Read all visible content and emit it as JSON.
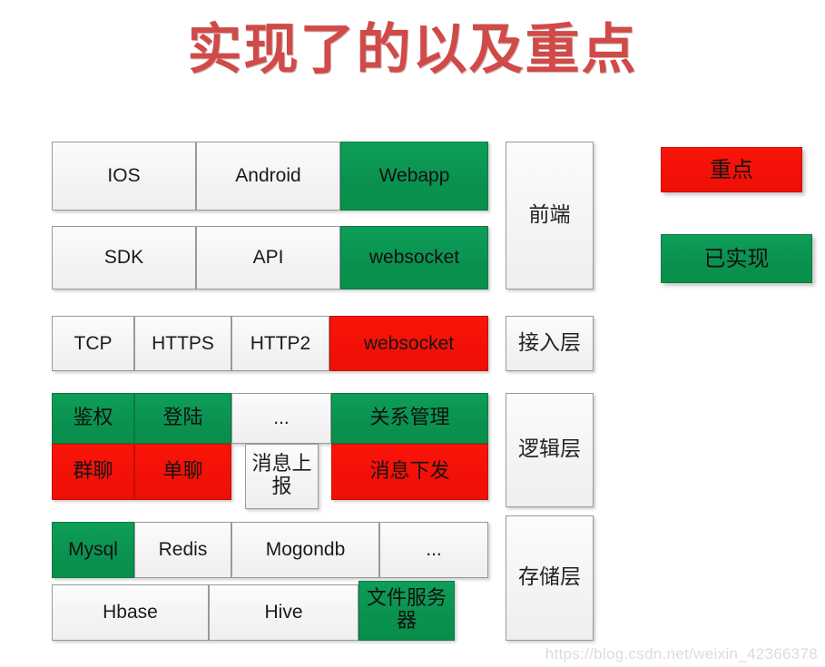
{
  "title": "实现了的以及重点",
  "colors": {
    "title": "#D04A48",
    "green": "#0A9150",
    "red": "#F21007",
    "neutral": "#F4F4F4",
    "border": "#9A9A9A"
  },
  "legend": {
    "items": [
      {
        "label": "重点",
        "color": "red"
      },
      {
        "label": "已实现",
        "color": "green"
      }
    ]
  },
  "layers": [
    {
      "name": "前端",
      "rows": [
        [
          {
            "label": "IOS",
            "color": "neutral"
          },
          {
            "label": "Android",
            "color": "neutral"
          },
          {
            "label": "Webapp",
            "color": "green"
          }
        ],
        [
          {
            "label": "SDK",
            "color": "neutral"
          },
          {
            "label": "API",
            "color": "neutral"
          },
          {
            "label": "websocket",
            "color": "green"
          }
        ]
      ]
    },
    {
      "name": "接入层",
      "rows": [
        [
          {
            "label": "TCP",
            "color": "neutral"
          },
          {
            "label": "HTTPS",
            "color": "neutral"
          },
          {
            "label": "HTTP2",
            "color": "neutral"
          },
          {
            "label": "websocket",
            "color": "red"
          }
        ]
      ]
    },
    {
      "name": "逻辑层",
      "rows": [
        [
          {
            "label": "鉴权",
            "color": "green"
          },
          {
            "label": "登陆",
            "color": "green"
          },
          {
            "label": "...",
            "color": "neutral"
          },
          {
            "label": "关系管理",
            "color": "green"
          }
        ],
        [
          {
            "label": "群聊",
            "color": "red"
          },
          {
            "label": "单聊",
            "color": "red"
          },
          {
            "label": "消息上报",
            "color": "neutral"
          },
          {
            "label": "消息下发",
            "color": "red"
          }
        ]
      ]
    },
    {
      "name": "存储层",
      "rows": [
        [
          {
            "label": "Mysql",
            "color": "green"
          },
          {
            "label": "Redis",
            "color": "neutral"
          },
          {
            "label": "Mogondb",
            "color": "neutral"
          },
          {
            "label": "...",
            "color": "neutral"
          }
        ],
        [
          {
            "label": "Hbase",
            "color": "neutral"
          },
          {
            "label": "Hive",
            "color": "neutral"
          },
          {
            "label": "文件服务器",
            "color": "green"
          }
        ]
      ]
    }
  ],
  "boxes": {
    "r1c1": "IOS",
    "r1c2": "Android",
    "r1c3": "Webapp",
    "r2c1": "SDK",
    "r2c2": "API",
    "r2c3": "websocket",
    "r3c1": "TCP",
    "r3c2": "HTTPS",
    "r3c3": "HTTP2",
    "r3c4": "websocket",
    "r4c1": "鉴权",
    "r4c2": "登陆",
    "r4c3": "...",
    "r4c4": "关系管理",
    "r5c1": "群聊",
    "r5c2": "单聊",
    "r5c3": "消息上报",
    "r5c4": "消息下发",
    "r6c1": "Mysql",
    "r6c2": "Redis",
    "r6c3": "Mogondb",
    "r6c4": "...",
    "r7c1": "Hbase",
    "r7c2": "Hive",
    "r7c3": "文件服务器",
    "layer_frontend": "前端",
    "layer_access": "接入层",
    "layer_logic": "逻辑层",
    "layer_storage": "存储层",
    "legend_key": "重点",
    "legend_done": "已实现"
  },
  "watermark": "https://blog.csdn.net/weixin_42366378"
}
